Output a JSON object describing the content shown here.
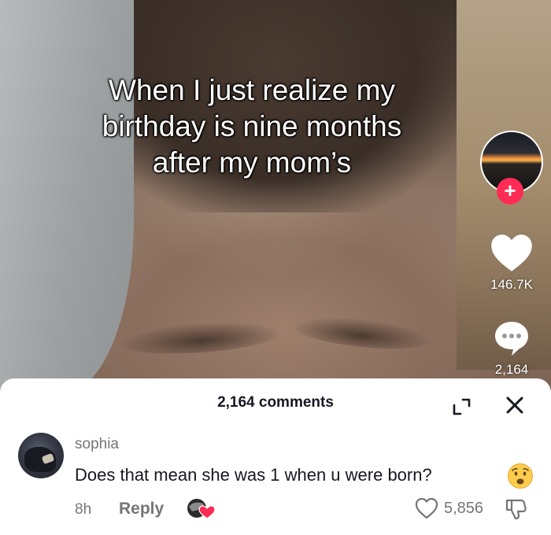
{
  "video": {
    "caption_lines": [
      "When I just realize my",
      "birthday is nine months",
      "after my mom’s"
    ]
  },
  "rail": {
    "profile_icon": "creator-avatar",
    "follow_symbol": "+",
    "like_count": "146.7K",
    "comment_count": "2,164",
    "colors": {
      "follow": "#fe2c55",
      "icons": "#ffffff"
    }
  },
  "comments_sheet": {
    "title": "2,164 comments",
    "icons": [
      "expand-icon",
      "close-icon"
    ]
  },
  "comment": {
    "username": "sophia",
    "text": "Does that mean she was 1 when u were born?",
    "emoji": "worried-face",
    "time": "8h",
    "reply_label": "Reply",
    "like_count": "5,856",
    "colors": {
      "secondary_text": "#757575",
      "primary_text": "#161823",
      "creator_like_heart": "#fe2c55"
    }
  }
}
